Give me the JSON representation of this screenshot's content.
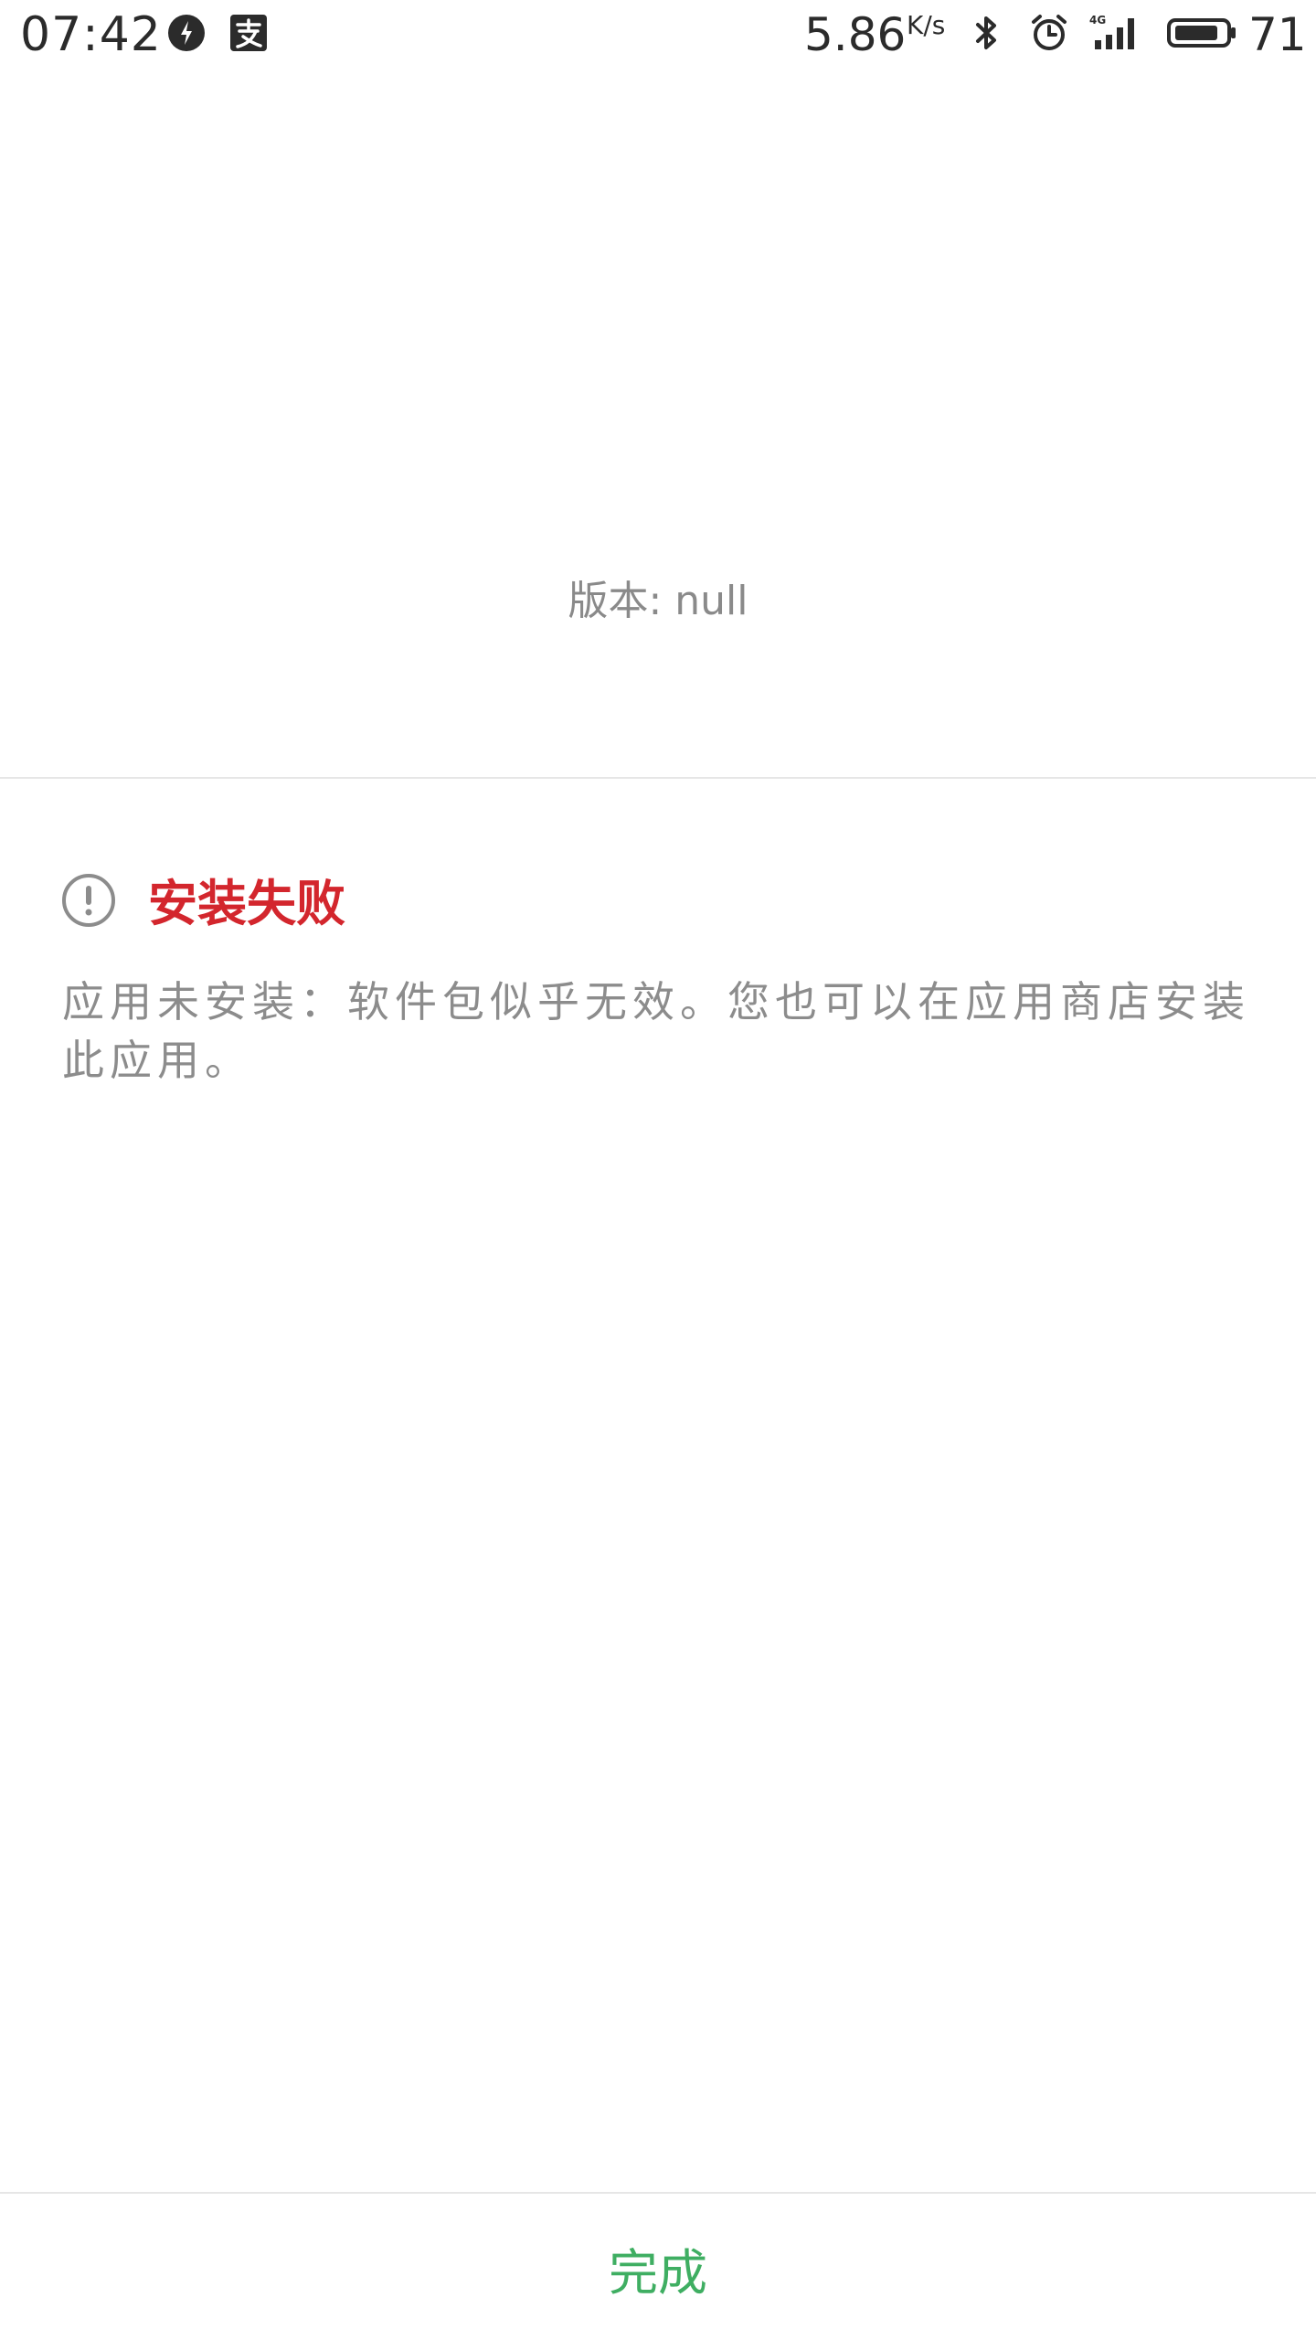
{
  "status_bar": {
    "time": "07:42",
    "network_speed": "5.86",
    "network_speed_unit": "K/s",
    "battery_level": "71",
    "network_type": "4G",
    "icons": [
      "notification-app-icon",
      "alipay-icon",
      "bluetooth-icon",
      "alarm-icon",
      "signal-icon",
      "battery-icon"
    ]
  },
  "version": {
    "text": "版本: null"
  },
  "result": {
    "title": "安装失败",
    "message": "应用未安装：软件包似乎无效。您也可以在应用商店安装此应用。",
    "title_color": "#d3262d"
  },
  "actions": {
    "done_label": "完成",
    "done_color": "#3fae62"
  }
}
